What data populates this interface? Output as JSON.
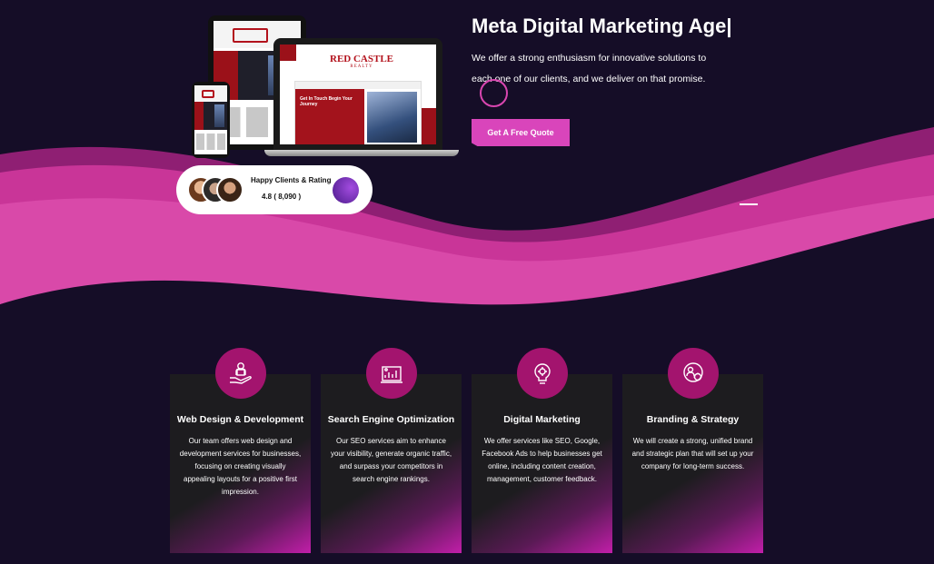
{
  "hero": {
    "title": "Meta Digital Marketing Age|",
    "description": "We offer a strong enthusiasm for innovative solutions to each one of our clients, and we deliver on that promise.",
    "cta_label": "Get A Free Quote"
  },
  "mockup": {
    "brand_name": "RED CASTLE",
    "brand_tagline": "REALTY",
    "hero_text": "Get In Touch Begin Your Journey"
  },
  "rating": {
    "title": "Happy Clients & Rating",
    "value": "4.8 ( 8,090 )"
  },
  "services": [
    {
      "title": "Web Design & Development",
      "text": "Our team offers web design and development services for businesses, focusing on creating visually appealing layouts for a positive first impression.",
      "icon": "designer-hand-icon"
    },
    {
      "title": "Search Engine Optimization",
      "text": "Our SEO services aim to enhance your visibility, generate organic traffic, and surpass your competitors in search engine rankings.",
      "icon": "seo-chart-icon"
    },
    {
      "title": "Digital Marketing",
      "text": "We offer services like SEO, Google, Facebook Ads to help businesses get online, including content creation, management, customer feedback.",
      "icon": "lightbulb-gear-icon"
    },
    {
      "title": "Branding & Strategy",
      "text": "We will create a strong, unified brand and strategic plan that will set up your company for long-term success.",
      "icon": "strategy-people-icon"
    }
  ],
  "colors": {
    "background": "#150d27",
    "accent": "#d945bb",
    "icon_circle": "#a3146e",
    "card": "#1d1c1f"
  }
}
